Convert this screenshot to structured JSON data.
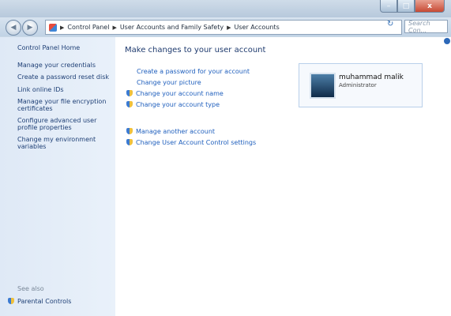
{
  "window": {
    "close_glyph": "x",
    "min_glyph": "–",
    "max_glyph": "□"
  },
  "nav": {
    "back_glyph": "◀",
    "forward_glyph": "▶"
  },
  "breadcrumb": [
    "Control Panel",
    "User Accounts and Family Safety",
    "User Accounts"
  ],
  "search": {
    "placeholder": "Search Con..."
  },
  "sidebar": {
    "home": "Control Panel Home",
    "links": [
      "Manage your credentials",
      "Create a password reset disk",
      "Link online IDs",
      "Manage your file encryption certificates",
      "Configure advanced user profile properties",
      "Change my environment variables"
    ],
    "see_also_label": "See also",
    "parental_controls": "Parental Controls"
  },
  "main": {
    "title": "Make changes to your user account",
    "links": [
      {
        "label": "Create a password for your account",
        "shield": false
      },
      {
        "label": "Change your picture",
        "shield": false
      },
      {
        "label": "Change your account name",
        "shield": true
      },
      {
        "label": "Change your account type",
        "shield": true
      }
    ],
    "links2": [
      {
        "label": "Manage another account",
        "shield": true
      },
      {
        "label": "Change User Account Control settings",
        "shield": true
      }
    ]
  },
  "user": {
    "name": "muhammad malik",
    "role": "Administrator"
  }
}
